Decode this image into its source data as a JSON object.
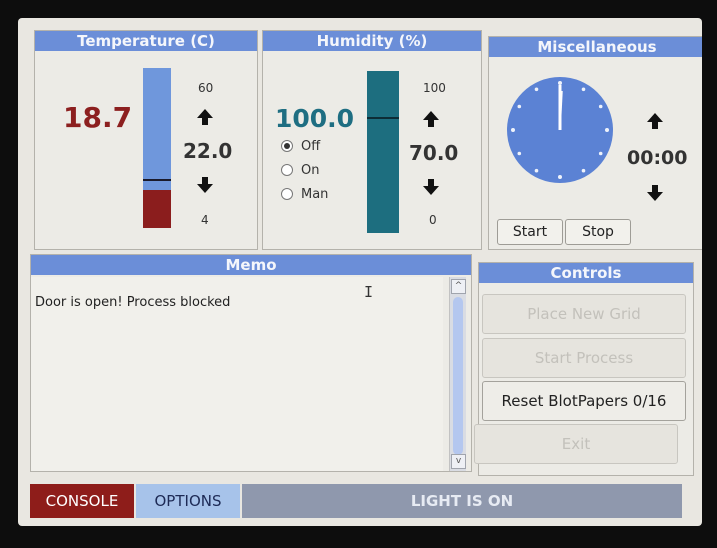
{
  "temperature": {
    "title": "Temperature (C)",
    "current": "18.7",
    "setpoint": "22.0",
    "max_label": "60",
    "min_label": "4",
    "level_fraction": 0.3
  },
  "humidity": {
    "title": "Humidity (%)",
    "current": "100.0",
    "setpoint": "70.0",
    "max_label": "100",
    "min_label": "0",
    "level_fraction": 1.0,
    "modes": [
      {
        "label": "Off",
        "selected": true
      },
      {
        "label": "On",
        "selected": false
      },
      {
        "label": "Man",
        "selected": false
      }
    ]
  },
  "misc": {
    "title": "Miscellaneous",
    "timer": "00:00",
    "start_label": "Start",
    "stop_label": "Stop"
  },
  "memo": {
    "title": "Memo",
    "text": "Door is open! Process blocked"
  },
  "controls": {
    "title": "Controls",
    "place_grid": "Place New Grid",
    "start_process": "Start Process",
    "reset_blotpapers": "Reset BlotPapers 0/16",
    "exit": "Exit"
  },
  "footer": {
    "console_tab": "CONSOLE",
    "options_tab": "OPTIONS",
    "status": "LIGHT IS ON"
  },
  "colors": {
    "title_bar": "#6b8ed8",
    "temp_value": "#8c1f1f",
    "humidity_value": "#1e6e82",
    "humidity_bar": "#1d6e7f",
    "temp_bar": "#6f97dc",
    "temp_fill": "#8b1d1d",
    "clock_face": "#5b82d4",
    "console_tab": "#8e1d1a",
    "options_tab": "#a7c3ea",
    "status_bar": "#8f98ad"
  },
  "icons": [
    "up-arrow-icon",
    "down-arrow-icon",
    "scrollbar-up-icon",
    "scrollbar-down-icon",
    "mouse-cursor-icon"
  ]
}
